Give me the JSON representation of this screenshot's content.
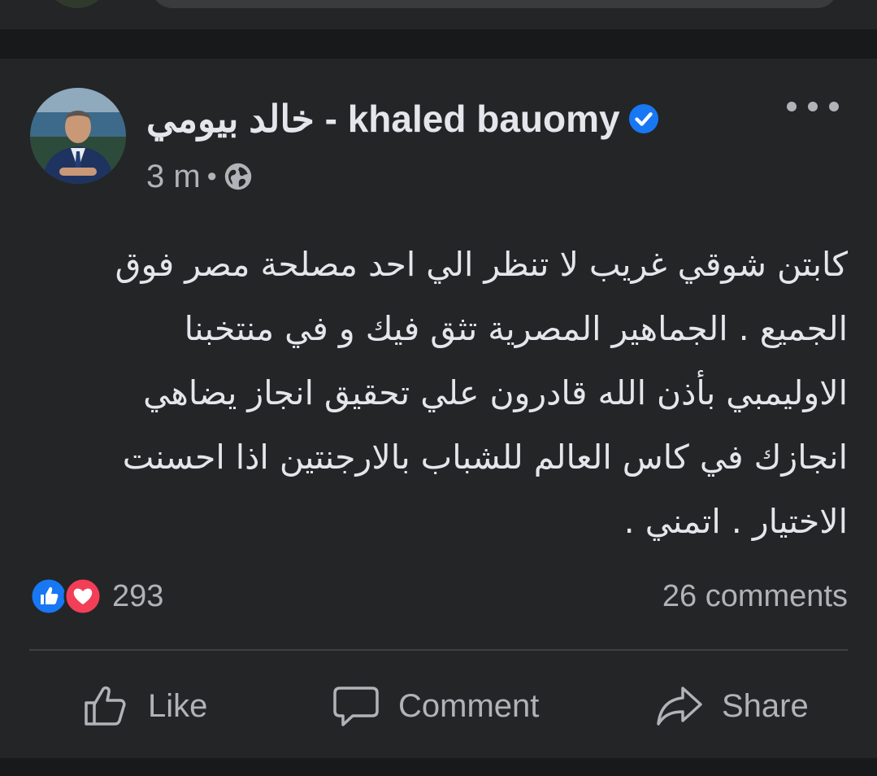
{
  "post": {
    "author": "خالد بيومي - khaled bauomy",
    "timestamp": "3 m",
    "separator": "•",
    "audience_icon": "globe-icon",
    "verified_icon": "verified-badge-icon",
    "more_icon": "more-options-icon",
    "text_lines": [
      "كابتن شوقي غريب لا تنظر الي احد مصلحة  مصر فوق",
      "الجميع . الجماهير المصرية تثق فيك و في منتخبنا",
      "الاوليمبي بأذن الله  قادرون علي تحقيق انجاز يضاهي",
      "انجازك في كاس العالم للشباب بالارجنتين  اذا احسنت",
      "الاختيار . اتمني ."
    ]
  },
  "reactions": {
    "count": "293",
    "icons": [
      "like-reaction-icon",
      "love-reaction-icon"
    ],
    "comments": "26 comments"
  },
  "actions": {
    "like": "Like",
    "comment": "Comment",
    "share": "Share"
  },
  "colors": {
    "background": "#18191a",
    "card": "#242526",
    "text": "#e4e6eb",
    "secondary": "#b0b3b8",
    "like_blue": "#1877f2",
    "love_red": "#f33e58"
  }
}
